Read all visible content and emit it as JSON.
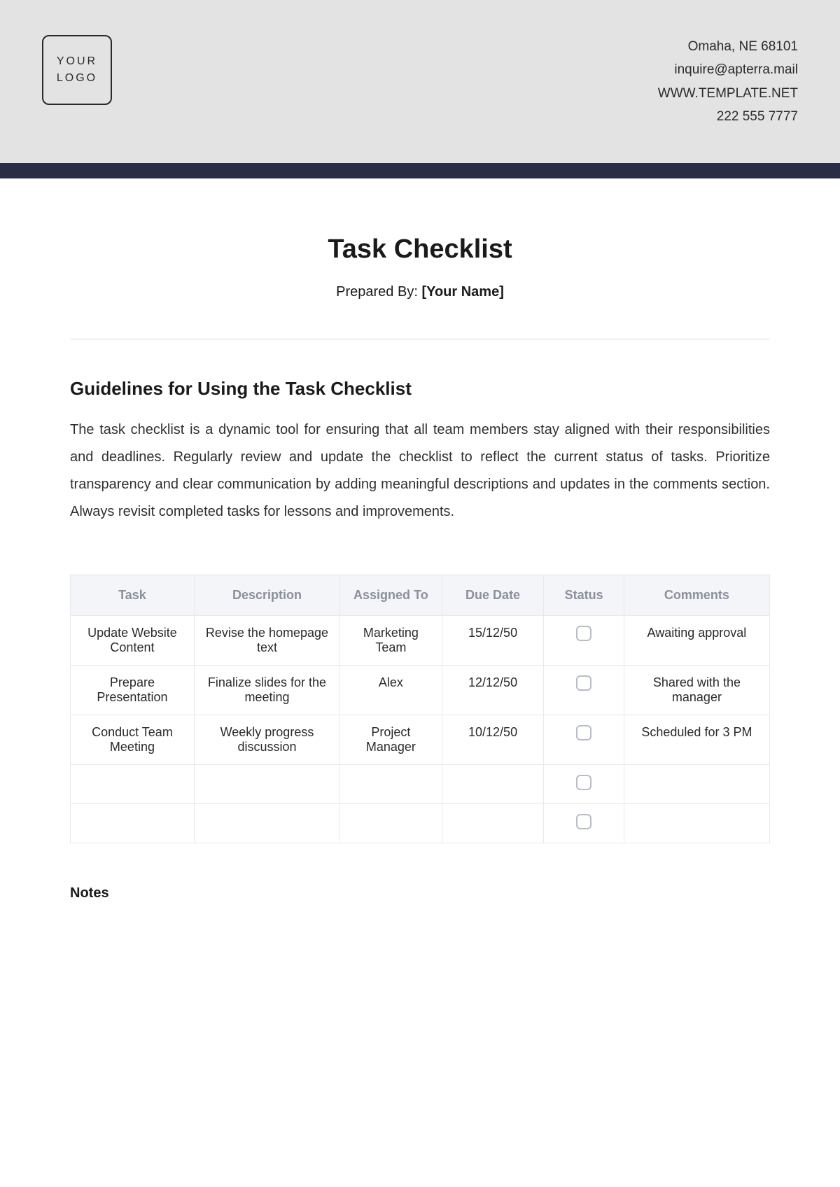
{
  "header": {
    "logo_line1": "YOUR",
    "logo_line2": "LOGO",
    "contact": {
      "address": "Omaha, NE 68101",
      "email": "inquire@apterra.mail",
      "website": "WWW.TEMPLATE.NET",
      "phone": "222 555 7777"
    }
  },
  "title": "Task Checklist",
  "prepared_label": "Prepared By: ",
  "prepared_value": "[Your Name]",
  "guidelines": {
    "heading": "Guidelines for Using the Task Checklist",
    "body": "The task checklist is a dynamic tool for ensuring that all team members stay aligned with their responsibilities and deadlines. Regularly review and update the checklist to reflect the current status of tasks. Prioritize transparency and clear communication by adding meaningful descriptions and updates in the comments section. Always revisit completed tasks for lessons and improvements."
  },
  "table": {
    "headers": {
      "task": "Task",
      "description": "Description",
      "assigned": "Assigned To",
      "due": "Due Date",
      "status": "Status",
      "comments": "Comments"
    },
    "rows": [
      {
        "task": "Update Website Content",
        "description": "Revise the homepage text",
        "assigned": "Marketing Team",
        "due": "15/12/50",
        "comments": "Awaiting approval"
      },
      {
        "task": "Prepare Presentation",
        "description": "Finalize slides for the meeting",
        "assigned": "Alex",
        "due": "12/12/50",
        "comments": "Shared with the manager"
      },
      {
        "task": "Conduct Team Meeting",
        "description": "Weekly progress discussion",
        "assigned": "Project Manager",
        "due": "10/12/50",
        "comments": "Scheduled for 3 PM"
      },
      {
        "task": "",
        "description": "",
        "assigned": "",
        "due": "",
        "comments": ""
      },
      {
        "task": "",
        "description": "",
        "assigned": "",
        "due": "",
        "comments": ""
      }
    ]
  },
  "notes_heading": "Notes"
}
